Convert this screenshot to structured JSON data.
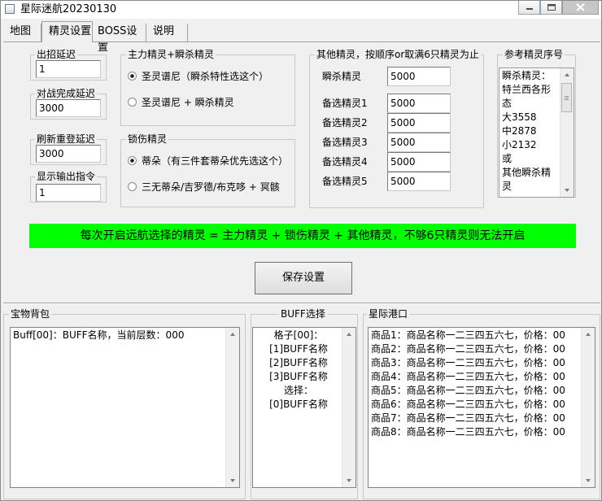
{
  "window": {
    "title": "星际迷航20230130"
  },
  "tabs": [
    "地图",
    "精灵设置",
    "BOSS设置",
    "说明"
  ],
  "settings": {
    "fields": [
      {
        "label": "出招延迟",
        "value": "1"
      },
      {
        "label": "对战完成延迟",
        "value": "3000"
      },
      {
        "label": "刷新重登延迟",
        "value": "3000"
      },
      {
        "label": "显示输出指令",
        "value": "1"
      }
    ]
  },
  "main_sprite": {
    "title": "主力精灵+瞬杀精灵",
    "options": [
      "圣灵谱尼（瞬杀特性选这个）",
      "圣灵谱尼 + 瞬杀精灵"
    ],
    "selected": 0
  },
  "lock_sprite": {
    "title": "锁伤精灵",
    "options": [
      "蒂朵（有三件套蒂朵优先选这个）",
      "三无蒂朵/吉罗德/布克哆 + 冥骸"
    ],
    "selected": 0
  },
  "other_sprites": {
    "title": "其他精灵，按顺序or取满6只精灵为止",
    "rows": [
      {
        "label": "瞬杀精灵",
        "value": "5000"
      },
      {
        "label": "备选精灵1",
        "value": "5000"
      },
      {
        "label": "备选精灵2",
        "value": "5000"
      },
      {
        "label": "备选精灵3",
        "value": "5000"
      },
      {
        "label": "备选精灵4",
        "value": "5000"
      },
      {
        "label": "备选精灵5",
        "value": "5000"
      }
    ]
  },
  "reference": {
    "title": "参考精灵序号",
    "lines": [
      "瞬杀精灵：",
      "特兰西各形",
      "态",
      "大3558",
      "中2878",
      "小2132",
      "或",
      "其他瞬杀精",
      "灵"
    ]
  },
  "notice": "每次开启远航选择的精灵 = 主力精灵 + 锁伤精灵 + 其他精灵，不够6只精灵则无法开启",
  "save_button": "保存设置",
  "bag": {
    "title": "宝物背包",
    "lines": [
      "Buff[00]：BUFF名称，当前层数：000"
    ]
  },
  "buff": {
    "title": "BUFF选择",
    "lines": [
      "格子[00]：",
      "[1]BUFF名称",
      "[2]BUFF名称",
      "[3]BUFF名称",
      "选择：",
      "[0]BUFF名称"
    ]
  },
  "port": {
    "title": "星际港口",
    "lines": [
      "商品1：商品名称一二三四五六七，价格：00",
      "商品2：商品名称一二三四五六七，价格：00",
      "商品3：商品名称一二三四五六七，价格：00",
      "商品4：商品名称一二三四五六七，价格：00",
      "商品5：商品名称一二三四五六七，价格：00",
      "商品6：商品名称一二三四五六七，价格：00",
      "商品7：商品名称一二三四五六七，价格：00",
      "商品8：商品名称一二三四五六七，价格：00"
    ]
  }
}
